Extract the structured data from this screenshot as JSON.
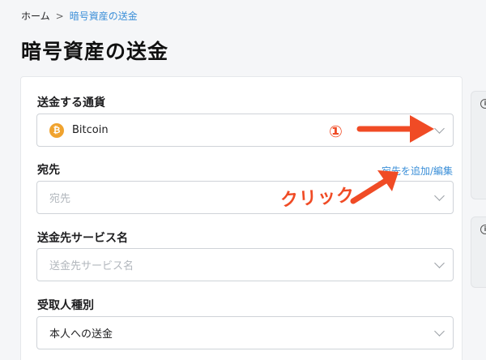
{
  "breadcrumb": {
    "home": "ホーム",
    "separator": ">",
    "current": "暗号資産の送金"
  },
  "page_title": "暗号資産の送金",
  "fields": {
    "currency": {
      "label": "送金する通貨",
      "value": "Bitcoin",
      "icon": "bitcoin-icon",
      "icon_glyph": "₿"
    },
    "destination": {
      "label": "宛先",
      "placeholder": "宛先",
      "link": "宛先を追加/編集"
    },
    "service_name": {
      "label": "送金先サービス名",
      "placeholder": "送金先サービス名"
    },
    "recipient_type": {
      "label": "受取人種別",
      "value": "本人への送金"
    }
  },
  "annotations": {
    "step_number": "①",
    "click_text": "クリック",
    "color": "#f04b25"
  },
  "colors": {
    "accent": "#3b8fd8",
    "bitcoin": "#f0a32f"
  }
}
